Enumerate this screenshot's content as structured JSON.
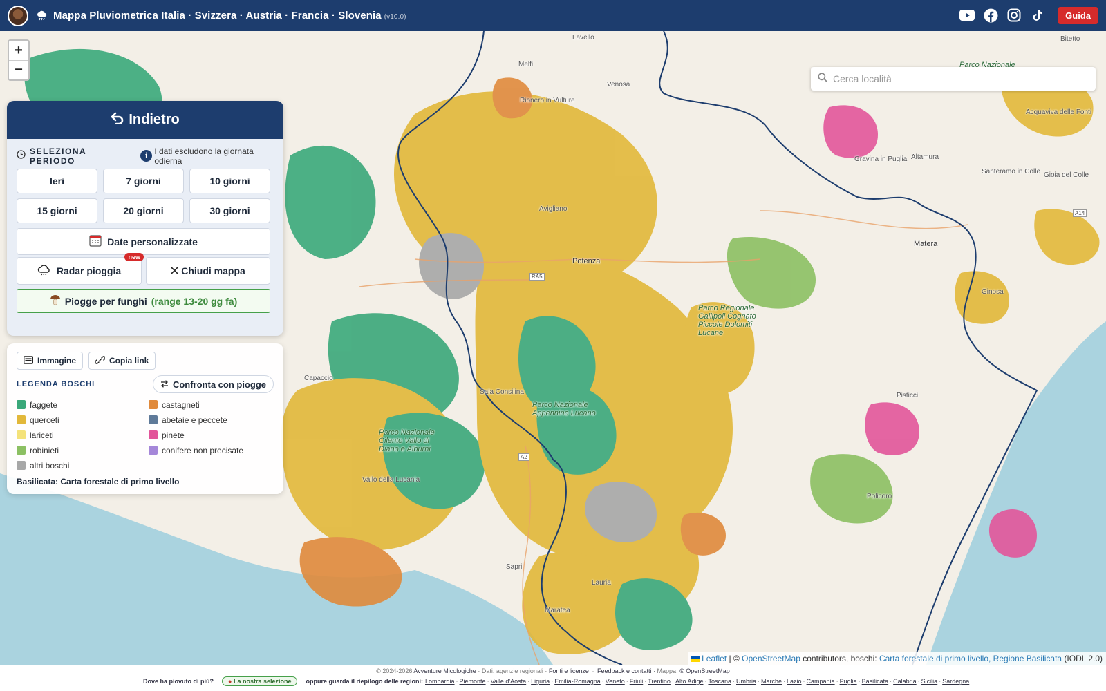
{
  "header": {
    "title": "Mappa Pluviometrica Italia · Svizzera · Austria · Francia · Slovenia",
    "version": "(v10.0)",
    "guide_label": "Guida",
    "social_icons": [
      "youtube-icon",
      "facebook-icon",
      "instagram-icon",
      "tiktok-icon"
    ],
    "bg_color": "#1d3d6e"
  },
  "map": {
    "zoom_in": "+",
    "zoom_out": "−",
    "search_placeholder": "Cerca località",
    "places": [
      "Lavello",
      "Bitetto",
      "Melfi",
      "Venosa",
      "Rionero in Vulture",
      "Parco Nazionale",
      "Gravina in Puglia",
      "Altamura",
      "Acquaviva delle Fonti",
      "Gioia del Colle",
      "Santeramo in Colle",
      "Avigliano",
      "Potenza",
      "Matera",
      "Ginosa",
      "Pisticci",
      "Policoro",
      "Sala Consilina",
      "Parco Nazionale Appennino Lucano",
      "Parco Nazionale Cilento Vallo di Diano e Alburni",
      "Vallo della Lucania",
      "Sapri",
      "Lauria",
      "Maratea",
      "Capaccio",
      "Parco Regionale Gallipoli Cognato Piccole Dolomiti Lucane",
      "RA5",
      "A2",
      "A14"
    ],
    "attribution": {
      "leaflet": "Leaflet",
      "sep": "|",
      "copy": "©",
      "osm": "OpenStreetMap",
      "contrib": "contributors, boschi:",
      "source": "Carta forestale di primo livello, Regione Basilicata",
      "license": "(IODL 2.0)"
    }
  },
  "period": {
    "back_label": "Indietro",
    "section_label": "SELEZIONA PERIODO",
    "note": "I dati escludono la giornata odierna",
    "buttons": [
      "Ieri",
      "7 giorni",
      "10 giorni",
      "15 giorni",
      "20 giorni",
      "30 giorni"
    ],
    "custom_dates": "Date personalizzate",
    "radar": "Radar pioggia",
    "new_badge": "new",
    "close_map": "Chiudi mappa",
    "fungi_label": "Piogge per funghi",
    "fungi_range": "(range 13-20 gg fa)"
  },
  "legend": {
    "image_btn": "Immagine",
    "copy_link_btn": "Copia link",
    "title": "LEGENDA BOSCHI",
    "compare_btn": "Confronta con piogge",
    "items": [
      {
        "label": "faggete",
        "color": "#3aa87a"
      },
      {
        "label": "castagneti",
        "color": "#e08a3c"
      },
      {
        "label": "querceti",
        "color": "#e2b83a"
      },
      {
        "label": "abetaie e peccete",
        "color": "#5f7a99"
      },
      {
        "label": "lariceti",
        "color": "#f4e27a"
      },
      {
        "label": "pinete",
        "color": "#e2559a"
      },
      {
        "label": "robinieti",
        "color": "#8cc063"
      },
      {
        "label": "conifere non precisate",
        "color": "#a587d9"
      },
      {
        "label": "altri boschi",
        "color": "#a7a7a7"
      }
    ],
    "source": "Basilicata: Carta forestale di primo livello"
  },
  "footer": {
    "copyright": "© 2024-2026",
    "site": "Avventure Micologiche",
    "data_note": "· Dati: agenzie regionali ·",
    "sources": "Fonti e licenze",
    "feedback": "Feedback e contatti",
    "map_label": "· Mappa:",
    "map_credit": "© OpenStreetMap",
    "question": "Dove ha piovuto di più?",
    "selection": "La nostra selezione",
    "or_text": "oppure guarda il riepilogo delle regioni:",
    "regions": [
      "Lombardia",
      "Piemonte",
      "Valle d'Aosta",
      "Liguria",
      "Emilia-Romagna",
      "Veneto",
      "Friuli",
      "Trentino",
      "Alto Adige",
      "Toscana",
      "Umbria",
      "Marche",
      "Lazio",
      "Campania",
      "Puglia",
      "Basilicata",
      "Calabria",
      "Sicilia",
      "Sardegna"
    ]
  }
}
